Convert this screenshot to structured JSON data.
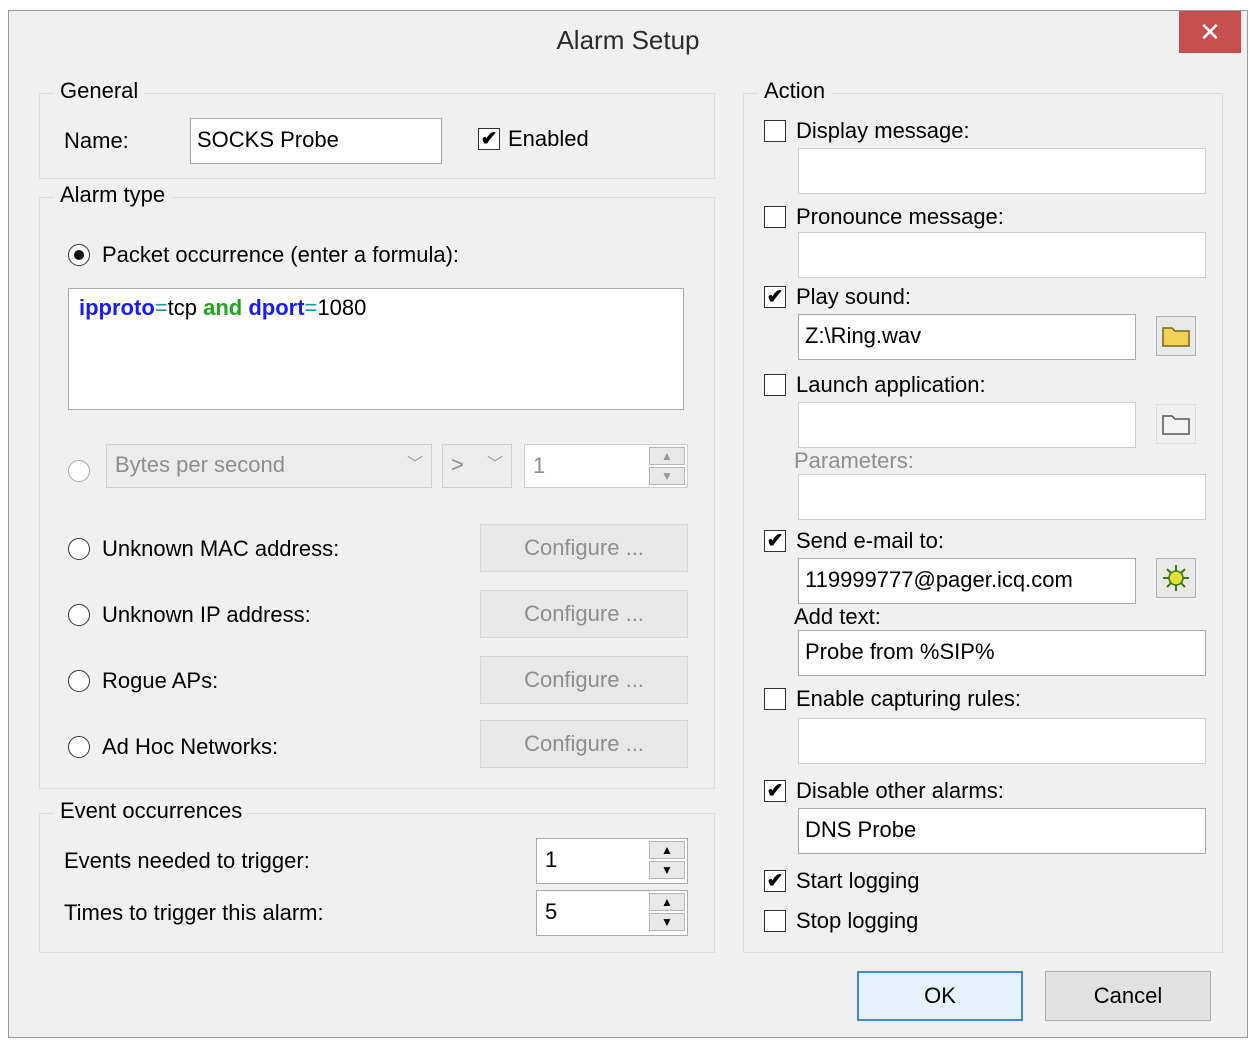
{
  "window": {
    "title": "Alarm Setup",
    "close_glyph": "✕"
  },
  "general": {
    "group_title": "General",
    "name_label": "Name:",
    "name_value": "SOCKS Probe",
    "enabled_label": "Enabled",
    "enabled_checked": true
  },
  "alarm_type": {
    "group_title": "Alarm type",
    "packet_label": "Packet occurrence (enter a formula):",
    "formula": {
      "t1": "ipproto",
      "t2": "=",
      "t3": "tcp",
      "t4": " and ",
      "t5": "dport",
      "t6": "=",
      "t7": "1080"
    },
    "bytes_combo": "Bytes per second",
    "op_combo": ">",
    "threshold_value": "1",
    "unknown_mac_label": "Unknown MAC address:",
    "unknown_ip_label": "Unknown IP address:",
    "rogue_aps_label": "Rogue APs:",
    "adhoc_label": "Ad Hoc Networks:",
    "configure_label": "Configure ..."
  },
  "events": {
    "group_title": "Event occurrences",
    "needed_label": "Events needed to trigger:",
    "needed_value": "1",
    "times_label": "Times to trigger this alarm:",
    "times_value": "5"
  },
  "action": {
    "group_title": "Action",
    "display_message_label": "Display message:",
    "display_message_value": "",
    "pronounce_message_label": "Pronounce message:",
    "pronounce_message_value": "",
    "play_sound_label": "Play sound:",
    "play_sound_value": "Z:\\Ring.wav",
    "launch_app_label": "Launch application:",
    "launch_app_value": "",
    "parameters_label": "Parameters:",
    "parameters_value": "",
    "send_email_label": "Send e-mail to:",
    "send_email_value": "119999777@pager.icq.com",
    "add_text_label": "Add text:",
    "add_text_value": "Probe from %SIP%",
    "capture_rules_label": "Enable capturing rules:",
    "capture_rules_value": "",
    "disable_alarms_label": "Disable other alarms:",
    "disable_alarms_value": "DNS Probe",
    "start_logging_label": "Start logging",
    "stop_logging_label": "Stop logging"
  },
  "buttons": {
    "ok": "OK",
    "cancel": "Cancel"
  },
  "check_glyph": "✔",
  "spin_up": "▲",
  "spin_down": "▼",
  "icons": {
    "folder": "folder-icon",
    "email_settings": "gear-icon"
  },
  "colors": {
    "close_button": "#c74f4f",
    "keyword_blue": "#1a1aff",
    "keyword_green": "#22a322",
    "folder_yellow": "#f2d15a"
  }
}
